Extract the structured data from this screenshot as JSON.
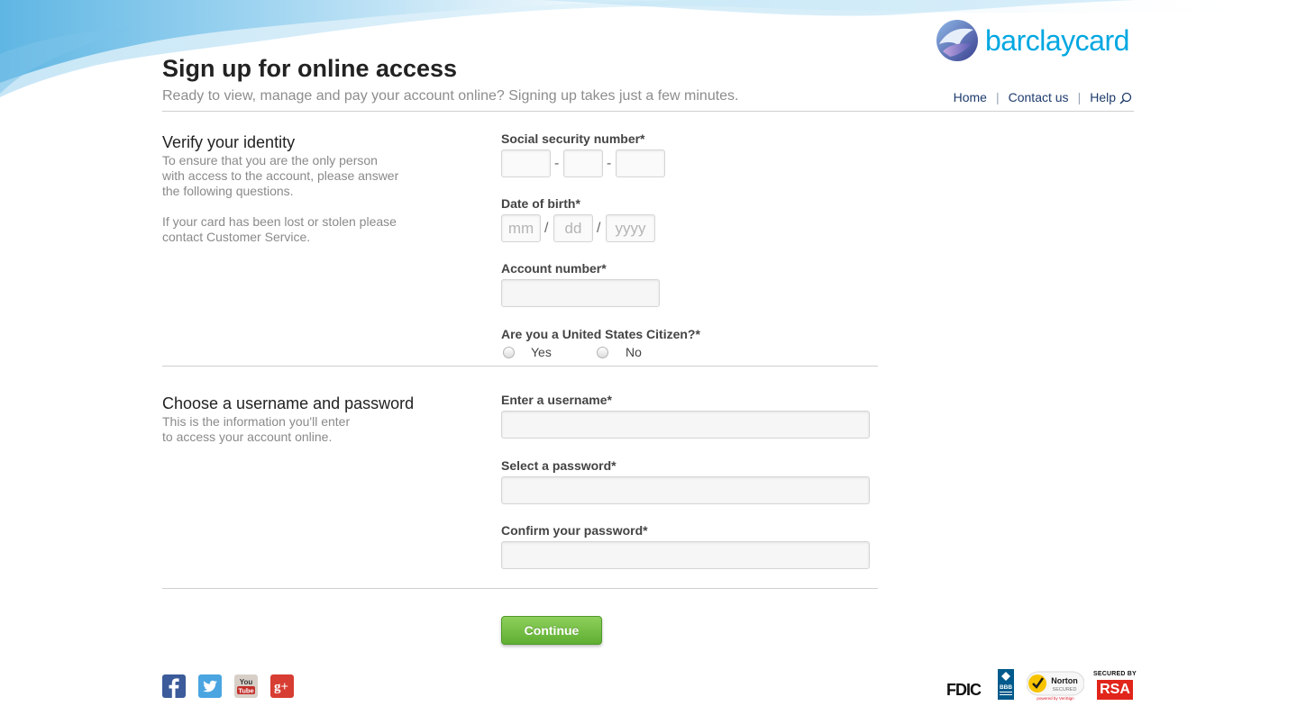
{
  "brand": {
    "name": "barclaycard",
    "color": "#00a7e1"
  },
  "header": {
    "title": "Sign up for online access",
    "subtitle": "Ready to view, manage and pay your account online? Signing up takes just a few minutes."
  },
  "nav": {
    "home": "Home",
    "sep1": "|",
    "contact": "Contact us",
    "sep2": "|",
    "help": "Help",
    "search_icon": "magnifier-icon"
  },
  "identity": {
    "title": "Verify your identity",
    "desc_1": "To ensure that you are the only person",
    "desc_2": "with access to the account, please answer",
    "desc_3": "the following questions.",
    "lost_1": "If your card has been lost or stolen please",
    "lost_2": "contact Customer Service.",
    "ssn_label": "Social security number*",
    "ssn_sep": "-",
    "dob_label": "Date of birth*",
    "dob_sep": "/",
    "dob_mm": "mm",
    "dob_dd": "dd",
    "dob_yyyy": "yyyy",
    "account_label": "Account number*",
    "citizen_label": "Are you a United States Citizen?*",
    "yes": "Yes",
    "no": "No"
  },
  "credentials": {
    "title": "Choose a username and password",
    "desc_1": "This is the information you'll enter",
    "desc_2": "to access your account online.",
    "username_label": "Enter a username*",
    "password_label": "Select a password*",
    "confirm_label": "Confirm your password*"
  },
  "actions": {
    "continue": "Continue",
    "continue_color": "#6cbf3c"
  },
  "footer": {
    "social_icons": [
      "facebook-icon",
      "twitter-icon",
      "youtube-icon",
      "google-plus-icon"
    ],
    "youtube_text_1": "You",
    "youtube_text_2": "Tube",
    "gplus_text": "g+",
    "fdic": "FDIC",
    "bbb": "BBB",
    "norton": "Norton",
    "norton_sub": "SECURED",
    "norton_powered": "powered by VeriSign",
    "secured_by": "SECURED BY",
    "rsa": "RSA"
  }
}
